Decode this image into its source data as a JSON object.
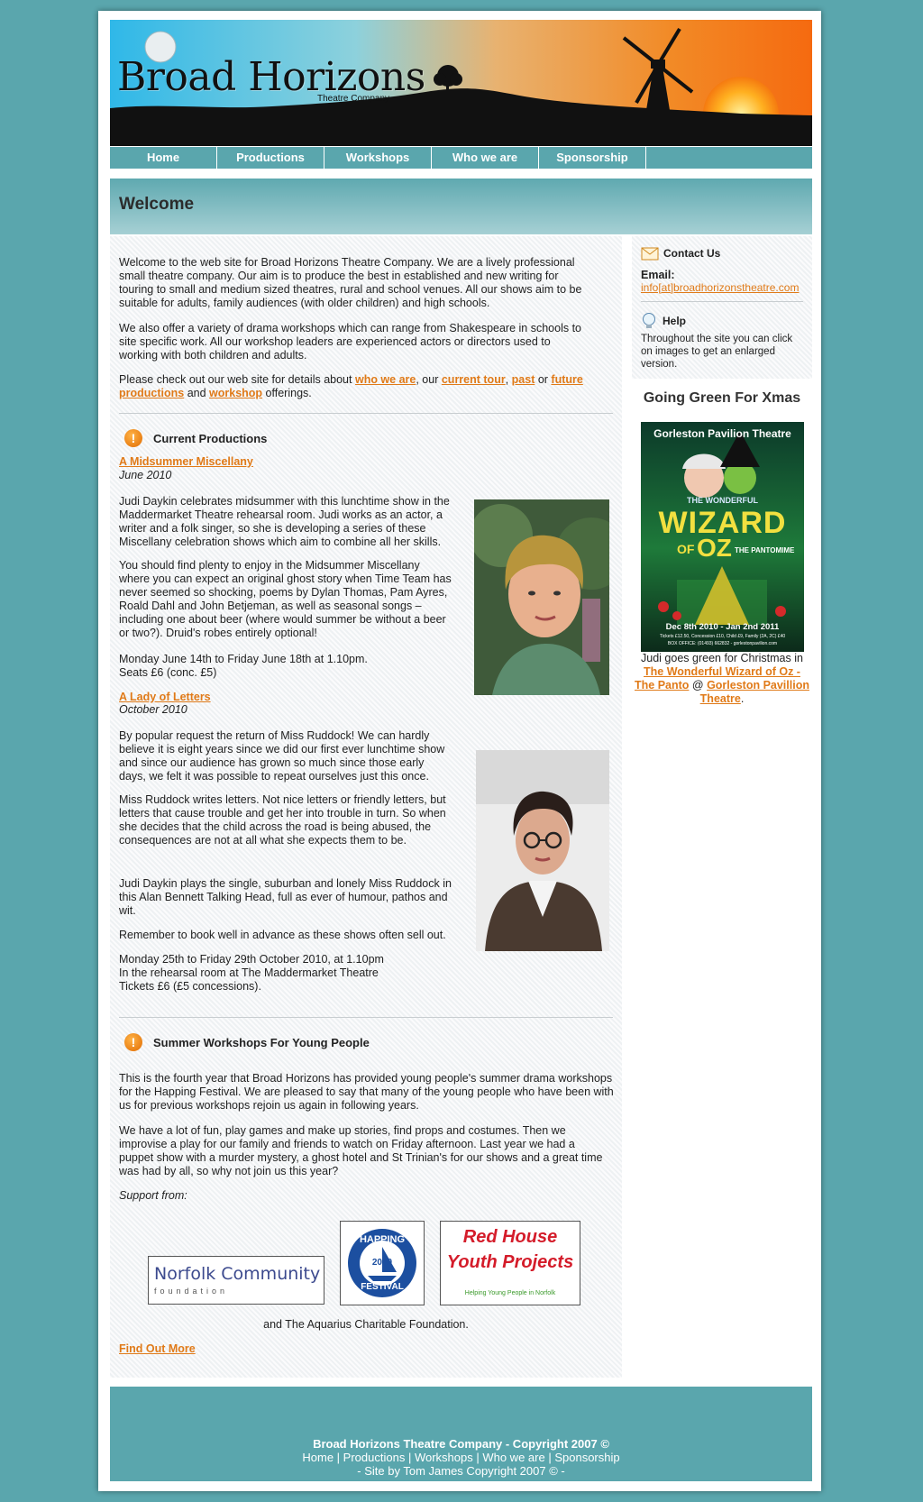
{
  "header": {
    "site_title": "Broad Horizons",
    "site_subtitle": "Theatre Company"
  },
  "nav": [
    {
      "label": "Home"
    },
    {
      "label": "Productions"
    },
    {
      "label": "Workshops"
    },
    {
      "label": "Who we are"
    },
    {
      "label": "Sponsorship"
    }
  ],
  "page": {
    "heading": "Welcome"
  },
  "intro": {
    "p1": "Welcome to the web site for Broad Horizons Theatre Company. We are a lively professional small theatre company. Our aim is to produce the best in established and new writing for touring to small and medium sized theatres, rural and school venues. All our shows aim to be suitable for adults, family audiences (with older children) and high schools.",
    "p2": "We also offer a variety of drama workshops which can range from Shakespeare in schools to site specific work. All our workshop leaders are experienced actors or directors used to working with both children and adults.",
    "p3_start": "Please check out our web site for details about ",
    "link_who": "who we are",
    "sep1": ", our ",
    "link_tour": "current tour",
    "sep2": ", ",
    "link_past": "past",
    "sep3": " or ",
    "link_future": "future productions",
    "sep4": " and ",
    "link_workshop": "workshop",
    "p3_end": " offerings."
  },
  "current_productions": {
    "heading": "Current Productions",
    "show1": {
      "title": "A Midsummer Miscellany",
      "date": "June 2010",
      "p1": "Judi Daykin celebrates midsummer with this lunchtime show in the Maddermarket Theatre rehearsal room. Judi works as an actor, a writer and a folk singer, so she is developing a series of these Miscellany celebration shows which aim to combine all her skills.",
      "p2": "You should find plenty to enjoy in the Midsummer Miscellany where you can expect an original ghost story when Time Team has never seemed so shocking, poems by Dylan Thomas, Pam Ayres, Roald Dahl and John Betjeman, as well as seasonal songs – including one about beer (where would summer be without a beer or two?). Druid's robes entirely optional!",
      "dates": "Monday June 14th to Friday June 18th at 1.10pm.",
      "seats": "Seats £6 (conc. £5)"
    },
    "show2": {
      "title": "A Lady of Letters",
      "date": "October 2010",
      "p1": "By popular request the return of Miss Ruddock! We can hardly believe it is eight years since we did our first ever lunchtime show and since our audience has grown so much since those early days, we felt it was possible to repeat ourselves just this once.",
      "p2": "Miss Ruddock writes letters. Not nice letters or friendly letters, but letters that cause trouble and get her into trouble in turn. So when she decides that the child across the road is being abused, the consequences are not at all what she expects them to be.",
      "p3": "Judi Daykin plays the single, suburban and lonely Miss Ruddock in this Alan Bennett Talking Head, full as ever of humour, pathos and wit.",
      "p4": "Remember to book well in advance as these shows often sell out.",
      "d1": "Monday 25th to Friday 29th October 2010, at 1.10pm",
      "d2": "In the rehearsal room at The Maddermarket Theatre",
      "d3": "Tickets £6 (£5 concessions)."
    }
  },
  "workshops": {
    "heading": "Summer Workshops For Young People",
    "p1": "This is the fourth year that Broad Horizons has provided young people's summer drama workshops for the Happing Festival. We are pleased to say that many of the young people who have been with us for previous workshops rejoin us again in following years.",
    "p2": "We have a lot of fun, play games and make up stories, find props and costumes. Then we improvise a play for our family and friends to watch on Friday afternoon. Last year we had a puppet show with a murder mystery, a ghost hotel and St Trinian's for our shows and a great time was had by all, so why not join us this year?",
    "support_label": "Support from:",
    "logo1_line1": "Norfolk Community",
    "logo1_line2": "foundation",
    "logo2_top": "HAPPING",
    "logo2_year": "2010",
    "logo2_bottom": "FESTIVAL",
    "logo3_line1": "Red House",
    "logo3_line2": "Youth Projects",
    "logo3_line3": "Helping Young People in Norfolk",
    "aquarius": "and The Aquarius Charitable Foundation.",
    "find_out_more": "Find Out More"
  },
  "sidebar": {
    "contact_heading": "Contact Us",
    "email_label": "Email:",
    "email_value": "info[at]broadhorizonstheatre.com",
    "help_heading": "Help",
    "help_text": "Throughout the site you can click on images to get an enlarged version.",
    "green_heading": "Going Green For Xmas",
    "poster_venue": "Gorleston Pavilion Theatre",
    "poster_the": "THE WONDERFUL",
    "poster_wizard": "WIZARD",
    "poster_of": "OF",
    "poster_oz": "OZ",
    "poster_panto": "THE PANTOMIME",
    "poster_dates": "Dec 8th 2010 - Jan 2nd 2011",
    "poster_tickets": "Tickets £12.50, Concession £10, Child £9, Family (2A, 2C) £40",
    "poster_box": "BOX OFFICE: (01493) 662832 - gorlestonpavilion.com",
    "caption_start": "Judi goes green for Christmas in ",
    "caption_link1": "The Wonderful Wizard of Oz - The Panto",
    "caption_mid": " @ ",
    "caption_link2": "Gorleston Pavillion Theatre",
    "caption_end": "."
  },
  "footer": {
    "copyright": "Broad Horizons Theatre Company - Copyright 2007 ©",
    "nav": [
      "Home",
      "Productions",
      "Workshops",
      "Who we are",
      "Sponsorship"
    ],
    "sep": " | ",
    "credit": "- Site by Tom James Copyright 2007 © -"
  },
  "colors": {
    "background": "#5aa6ad",
    "accent_link": "#e07a18",
    "nav_bar": "#5aa6ad"
  }
}
